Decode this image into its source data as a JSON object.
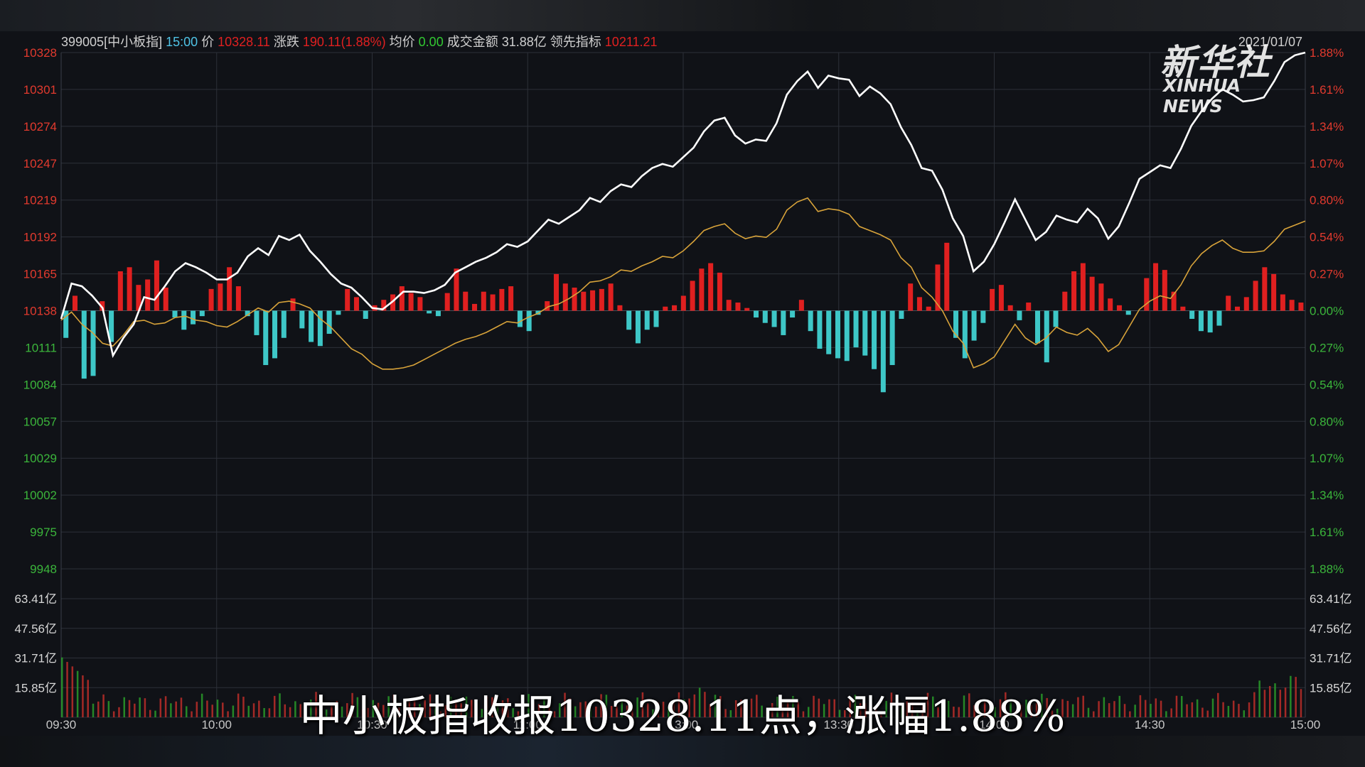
{
  "header": {
    "code": "399005[中小板指]",
    "time": "15:00",
    "price_label": "价",
    "price": "10328.11",
    "change_label": "涨跌",
    "change": "190.11(1.88%)",
    "avg_label": "均价",
    "avg": "0.00",
    "turnover_label": "成交金额",
    "turnover": "31.88亿",
    "lead_label": "领先指标",
    "lead": "10211.21",
    "date": "2021/01/07"
  },
  "logo": {
    "cn": "新华社",
    "en": "XINHUA NEWS"
  },
  "subtitle": "中小板指收报10328.11点，涨幅1.88%",
  "colors": {
    "background": "#101217",
    "grid": "#2c3038",
    "up": "#e02020",
    "down": "#3ec7c7",
    "price_line": "#ffffff",
    "lead_line": "#d8a33a",
    "tick_up": "#e23a2e",
    "tick_down": "#3bb53b",
    "volume_text": "#d8d8d8",
    "time_text": "#c8c8c8",
    "header_text": "#d0d0d0",
    "header_cyan": "#4fc3e6",
    "header_green": "#32c832"
  },
  "chart_data": {
    "type": "line",
    "base": 10138,
    "ylim": [
      9948,
      10328
    ],
    "y_ticks_left": [
      "10328",
      "10301",
      "10274",
      "10247",
      "10219",
      "10192",
      "10165",
      "10138",
      "10111",
      "10084",
      "10057",
      "10029",
      "10002",
      "9975",
      "9948"
    ],
    "y_ticks_right": [
      "1.88%",
      "1.61%",
      "1.34%",
      "1.07%",
      "0.80%",
      "0.54%",
      "0.27%",
      "0.00%",
      "0.27%",
      "0.54%",
      "0.80%",
      "1.07%",
      "1.34%",
      "1.61%",
      "1.88%"
    ],
    "volume_ticks": [
      "63.41亿",
      "47.56亿",
      "31.71亿",
      "15.85亿"
    ],
    "volume_max": 79.26,
    "x_labels": [
      "09:30",
      "10:00",
      "10:30",
      "11:00",
      "13:00",
      "13:30",
      "14:00",
      "14:30",
      "15:00"
    ],
    "series": [
      {
        "values": [
          10132,
          10158,
          10156,
          10149,
          10140,
          10105,
          10118,
          10128,
          10148,
          10146,
          10156,
          10167,
          10173,
          10170,
          10166,
          10161,
          10161,
          10166,
          10178,
          10184,
          10179,
          10193,
          10190,
          10194,
          10182,
          10174,
          10165,
          10158,
          10155,
          10148,
          10140,
          10139,
          10145,
          10152,
          10152,
          10151,
          10153,
          10157,
          10166,
          10170,
          10174,
          10177,
          10181,
          10187,
          10185,
          10189,
          10197,
          10205,
          10202,
          10207,
          10212,
          10221,
          10218,
          10226,
          10231,
          10229,
          10237,
          10243,
          10246,
          10244,
          10251,
          10258,
          10270,
          10278,
          10280,
          10267,
          10261,
          10264,
          10263,
          10276,
          10297,
          10307,
          10314,
          10302,
          10311,
          10309,
          10308,
          10296,
          10303,
          10298,
          10290,
          10273,
          10260,
          10243,
          10241,
          10227,
          10206,
          10193,
          10167,
          10174,
          10187,
          10203,
          10220,
          10205,
          10190,
          10196,
          10208,
          10205,
          10203,
          10213,
          10206,
          10191,
          10200,
          10217,
          10235,
          10240,
          10245,
          10243,
          10257,
          10274,
          10285,
          10294,
          10301,
          10297,
          10292,
          10293,
          10295,
          10307,
          10321,
          10326,
          10328
        ]
      },
      {
        "values": [
          10131,
          10137,
          10128,
          10122,
          10114,
          10112,
          10120,
          10130,
          10131,
          10128,
          10129,
          10133,
          10134,
          10131,
          10130,
          10127,
          10126,
          10130,
          10135,
          10140,
          10137,
          10144,
          10145,
          10143,
          10140,
          10132,
          10126,
          10118,
          10110,
          10106,
          10099,
          10095,
          10095,
          10096,
          10098,
          10102,
          10106,
          10110,
          10114,
          10117,
          10119,
          10122,
          10126,
          10130,
          10129,
          10133,
          10136,
          10141,
          10143,
          10147,
          10152,
          10159,
          10160,
          10163,
          10168,
          10167,
          10171,
          10174,
          10178,
          10177,
          10182,
          10189,
          10197,
          10200,
          10202,
          10195,
          10191,
          10193,
          10192,
          10198,
          10212,
          10218,
          10221,
          10211,
          10213,
          10212,
          10209,
          10200,
          10197,
          10194,
          10190,
          10177,
          10170,
          10155,
          10148,
          10138,
          10123,
          10114,
          10096,
          10099,
          10104,
          10116,
          10128,
          10118,
          10113,
          10118,
          10126,
          10122,
          10120,
          10125,
          10118,
          10108,
          10113,
          10126,
          10139,
          10145,
          10149,
          10147,
          10157,
          10171,
          10180,
          10186,
          10190,
          10184,
          10181,
          10181,
          10182,
          10189,
          10198,
          10201,
          10204
        ]
      }
    ],
    "bars": [
      -20,
      11,
      -50,
      -48,
      7,
      -23,
      29,
      32,
      19,
      23,
      37,
      17,
      -5,
      -14,
      -10,
      -4,
      16,
      20,
      32,
      18,
      -4,
      -18,
      -40,
      -35,
      -20,
      9,
      -13,
      -23,
      -26,
      -17,
      -3,
      16,
      10,
      -6,
      4,
      8,
      12,
      18,
      13,
      10,
      -2,
      -4,
      13,
      31,
      14,
      5,
      14,
      12,
      16,
      18,
      -12,
      -15,
      -3,
      7,
      27,
      20,
      17,
      14,
      15,
      16,
      20,
      4,
      -14,
      -24,
      -14,
      -12,
      3,
      4,
      11,
      22,
      31,
      35,
      28,
      8,
      6,
      2,
      -5,
      -9,
      -12,
      -18,
      -5,
      8,
      -15,
      -28,
      -32,
      -35,
      -37,
      -27,
      -33,
      -43,
      -60,
      -40,
      -6,
      20,
      10,
      3,
      34,
      50,
      -20,
      -35,
      -22,
      -9,
      16,
      19,
      4,
      -7,
      6,
      -24,
      -38,
      -12,
      14,
      29,
      35,
      25,
      20,
      9,
      4,
      -3,
      0,
      24,
      35,
      30,
      14,
      3,
      -6,
      -15,
      -16,
      -11,
      11,
      3,
      10,
      22,
      32,
      27,
      12,
      8,
      6
    ]
  }
}
